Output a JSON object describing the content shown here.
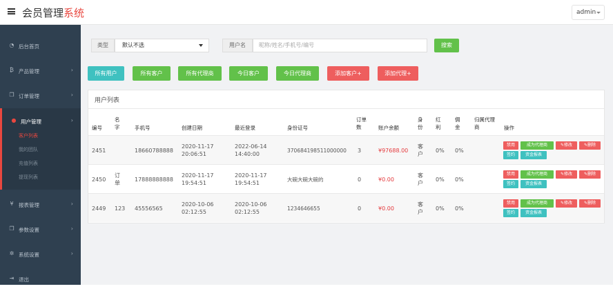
{
  "header": {
    "title_main": "会员管理",
    "title_accent": "系统",
    "user": "admin"
  },
  "sidebar": {
    "items": [
      {
        "label": "后台首页",
        "icon": "dashboard-icon"
      },
      {
        "label": "产品管理",
        "icon": "bitcoin-icon"
      },
      {
        "label": "订单管理",
        "icon": "copy-icon"
      },
      {
        "label": "用户管理",
        "icon": "user-icon"
      },
      {
        "label": "报表管理",
        "icon": "yen-icon"
      },
      {
        "label": "参数设置",
        "icon": "copy-icon"
      },
      {
        "label": "系统设置",
        "icon": "gears-icon"
      },
      {
        "label": "退出",
        "icon": "logout-icon"
      }
    ],
    "sub_items": [
      "客户列表",
      "我的团队",
      "充值列表",
      "提现列表"
    ]
  },
  "filter": {
    "type_label": "类型",
    "type_value": "默认不选",
    "user_label": "用户名",
    "user_placeholder": "昵称/姓名/手机号/编号",
    "search_label": "搜索"
  },
  "quick_buttons": [
    "所有用户",
    "所有客户",
    "所有代理商",
    "今日客户",
    "今日代理商",
    "添加客户+",
    "添加代理+"
  ],
  "panel": {
    "title": "用户列表"
  },
  "table": {
    "headers": {
      "id": "编号",
      "name": "名字",
      "phone": "手机号",
      "created": "创建日期",
      "last_login": "最近登录",
      "id_card": "身份证号",
      "orders": "订单数",
      "balance": "账户余额",
      "role": "身份",
      "bonus": "红利",
      "commission": "佣金",
      "agent": "归属代理商",
      "ops": "操作"
    },
    "rows": [
      {
        "id": "2451",
        "name": "",
        "phone": "18660788888",
        "created_date": "2020-11-17",
        "created_time": "20:06:51",
        "login_date": "2022-06-14",
        "login_time": "14:40:00",
        "id_card": "370684198511000000",
        "orders": "3",
        "balance": "¥97688.00",
        "role": "客户",
        "bonus": "0%",
        "commission": "0%",
        "agent": ""
      },
      {
        "id": "2450",
        "name": "订单",
        "phone": "17888888888",
        "created_date": "2020-11-17",
        "created_time": "19:54:51",
        "login_date": "2020-11-17",
        "login_time": "19:54:51",
        "id_card": "大碗大碗大碗的",
        "orders": "0",
        "balance": "¥0.00",
        "role": "客户",
        "bonus": "0%",
        "commission": "0%",
        "agent": ""
      },
      {
        "id": "2449",
        "name": "123",
        "phone": "45556565",
        "created_date": "2020-10-06",
        "created_time": "02:12:55",
        "login_date": "2020-10-06",
        "login_time": "02:12:55",
        "id_card": "1234646655",
        "orders": "0",
        "balance": "¥0.00",
        "role": "客户",
        "bonus": "0%",
        "commission": "0%",
        "agent": ""
      }
    ],
    "actions": {
      "disable": "禁用",
      "become_agent": "成为代理商",
      "edit": "✎修改",
      "delete": "✎删除",
      "sign": "签约",
      "report": "资金报表"
    }
  },
  "colors": {
    "sidebar": "#2f4050",
    "accent": "#e8473f",
    "teal": "#3fc1c0",
    "green": "#62c14a",
    "red": "#ee5e5e"
  }
}
